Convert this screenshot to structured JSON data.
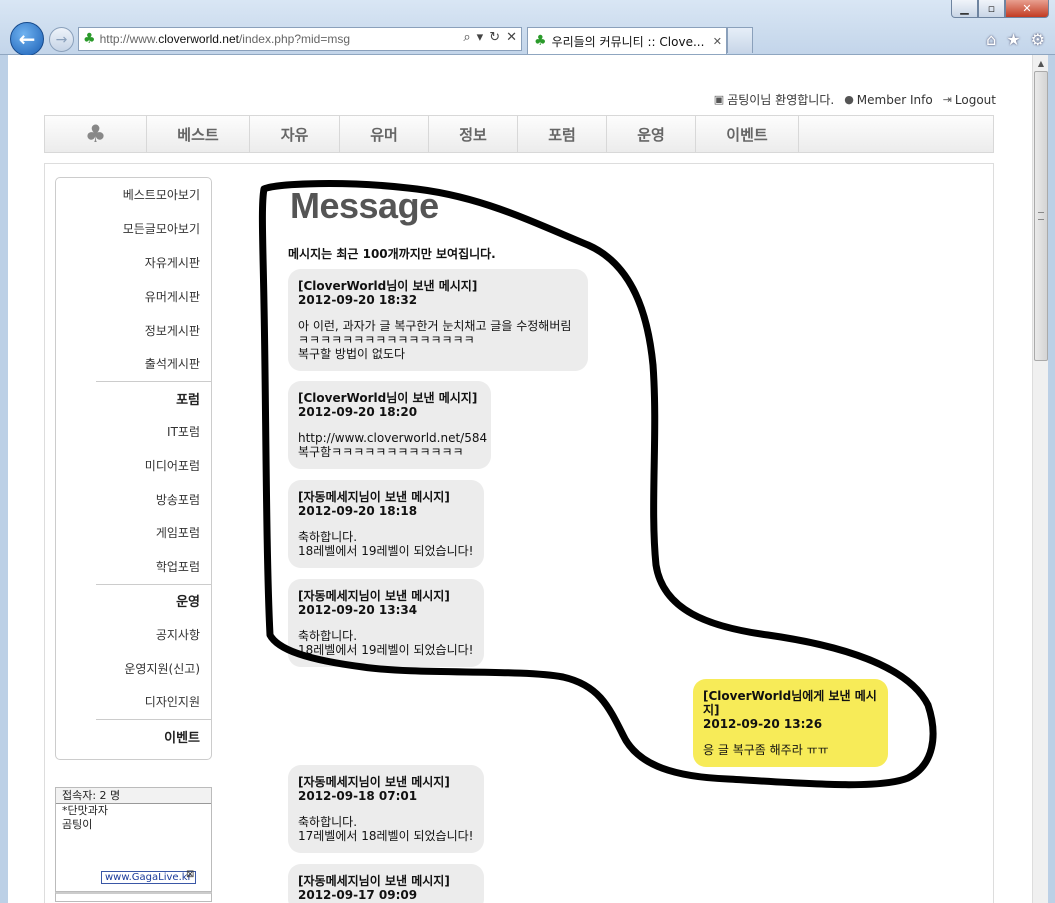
{
  "browser": {
    "url_prefix": "http://www.",
    "url_domain": "cloverworld.net",
    "url_path": "/index.php?mid=msg",
    "tab_title": "우리들의 커뮤니티 :: Clove...",
    "tab_close": "✕",
    "min_glyph": "▁",
    "max_glyph": "▫",
    "close_glyph": "✕",
    "back_glyph": "←",
    "forward_glyph": "→",
    "search_glyph": "⌕",
    "dropdown_glyph": "▾",
    "refresh_glyph": "↻",
    "stop_glyph": "✕",
    "home_glyph": "⌂",
    "favorites_glyph": "★",
    "tools_glyph": "⚙",
    "favicon_glyph": "♣"
  },
  "user_bar": {
    "welcome": "곰팅이님 환영합니다.",
    "member_info": "Member Info",
    "logout": "Logout"
  },
  "nav": {
    "logo_glyph": "♣",
    "items": [
      "베스트",
      "자유",
      "유머",
      "정보",
      "포럼",
      "운영",
      "이벤트"
    ]
  },
  "sidebar": {
    "items": [
      {
        "label": "베스트모아보기",
        "head": false
      },
      {
        "label": "모든글모아보기",
        "head": false
      },
      {
        "label": "자유게시판",
        "head": false
      },
      {
        "label": "유머게시판",
        "head": false
      },
      {
        "label": "정보게시판",
        "head": false
      },
      {
        "label": "출석게시판",
        "head": false
      },
      {
        "label": "포럼",
        "head": true
      },
      {
        "label": "IT포럼",
        "head": false
      },
      {
        "label": "미디어포럼",
        "head": false
      },
      {
        "label": "방송포럼",
        "head": false
      },
      {
        "label": "게임포럼",
        "head": false
      },
      {
        "label": "학업포럼",
        "head": false
      },
      {
        "label": "운영",
        "head": true
      },
      {
        "label": "공지사항",
        "head": false
      },
      {
        "label": "운영지원(신고)",
        "head": false
      },
      {
        "label": "디자인지원",
        "head": false
      },
      {
        "label": "이벤트",
        "head": true
      }
    ]
  },
  "online": {
    "header": "접속자: 2 명",
    "users": [
      "*단맛과자",
      "곰팅이"
    ],
    "badge": "www.GagaLive.kr",
    "badge_close": "⊠"
  },
  "messages": {
    "title": "Message",
    "note": "메시지는 최근 100개까지만 보여집니다.",
    "items": [
      {
        "from": "[CloverWorld님이 보낸 메시지]",
        "date": "2012-09-20 18:32",
        "body": "아 이런, 과자가 글 복구한거 눈치채고 글을 수정해버림\nㅋㅋㅋㅋㅋㅋㅋㅋㅋㅋㅋㅋㅋㅋㅋㅋ\n복구할 방법이 없도다",
        "sent": false
      },
      {
        "from": "[CloverWorld님이 보낸 메시지]",
        "date": "2012-09-20 18:20",
        "body": "http://www.cloverworld.net/584\n복구함ㅋㅋㅋㅋㅋㅋㅋㅋㅋㅋㅋㅋ",
        "sent": false
      },
      {
        "from": "[자동메세지님이 보낸 메시지]",
        "date": "2012-09-20 18:18",
        "body": "축하합니다.\n18레벨에서 19레벨이 되었습니다!",
        "sent": false
      },
      {
        "from": "[자동메세지님이 보낸 메시지]",
        "date": "2012-09-20 13:34",
        "body": "축하합니다.\n18레벨에서 19레벨이 되었습니다!",
        "sent": false
      },
      {
        "from": "[CloverWorld님에게 보낸 메시지]",
        "date": "2012-09-20 13:26",
        "body": "응 글 복구좀 해주라 ㅠㅠ",
        "sent": true
      },
      {
        "from": "[자동메세지님이 보낸 메시지]",
        "date": "2012-09-18 07:01",
        "body": "축하합니다.\n17레벨에서 18레벨이 되었습니다!",
        "sent": false
      },
      {
        "from": "[자동메세지님이 보낸 메시지]",
        "date": "2012-09-17 09:09",
        "body": "",
        "sent": false
      }
    ]
  }
}
